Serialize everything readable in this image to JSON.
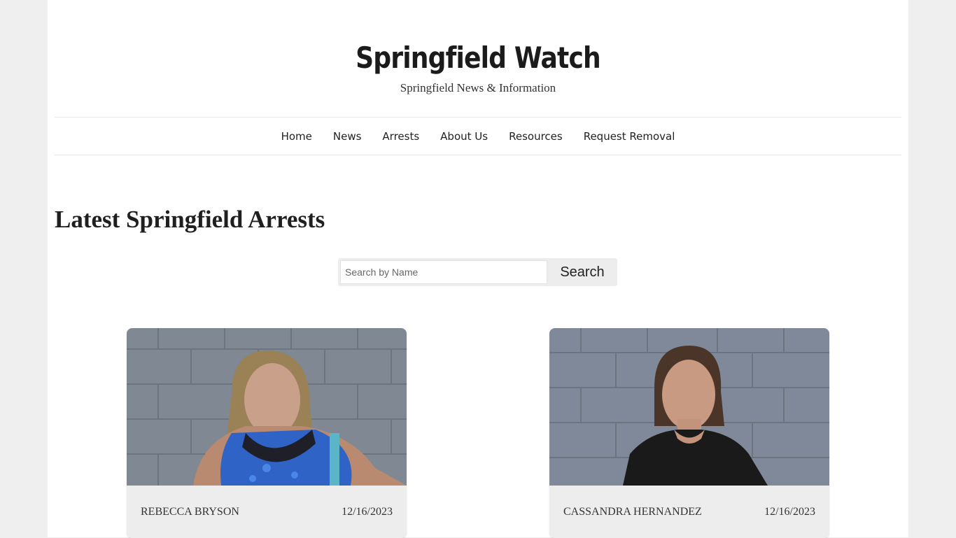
{
  "site": {
    "title": "Springfield Watch",
    "tagline": "Springfield News & Information"
  },
  "nav": {
    "items": [
      {
        "label": "Home"
      },
      {
        "label": "News"
      },
      {
        "label": "Arrests"
      },
      {
        "label": "About Us"
      },
      {
        "label": "Resources"
      },
      {
        "label": "Request Removal"
      }
    ]
  },
  "main": {
    "heading": "Latest Springfield Arrests",
    "search": {
      "placeholder": "Search by Name",
      "value": "",
      "button_label": "Search"
    },
    "cards": [
      {
        "name": "REBECCA BRYSON",
        "date": "12/16/2023",
        "photo_icon": "mugshot-photo"
      },
      {
        "name": "CASSANDRA HERNANDEZ",
        "date": "12/16/2023",
        "photo_icon": "mugshot-photo"
      }
    ]
  },
  "colors": {
    "page_background": "#efefef",
    "content_background": "#ffffff",
    "card_background": "#ededed",
    "wall": "#7e8792"
  }
}
